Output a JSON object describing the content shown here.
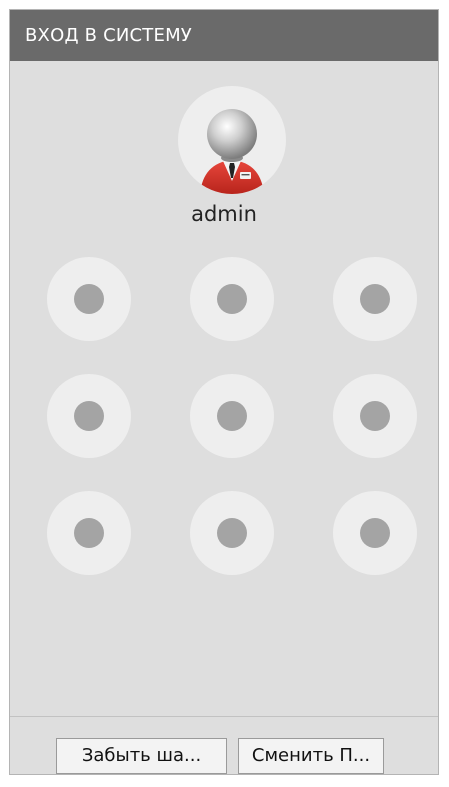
{
  "titlebar": {
    "title": "ВХОД В СИСТЕМУ"
  },
  "user": {
    "avatar_icon": "user-avatar-icon",
    "username": "admin"
  },
  "pattern": {
    "rows": 3,
    "cols": 3
  },
  "footer": {
    "forgot_label": "Забыть ша...",
    "change_label": "Сменить П..."
  },
  "colors": {
    "titlebar_bg": "#6a6a6a",
    "panel_bg": "#dedede",
    "dot_outer": "#eeeeee",
    "dot_inner": "#a4a4a4",
    "avatar_accent": "#d9382f"
  }
}
